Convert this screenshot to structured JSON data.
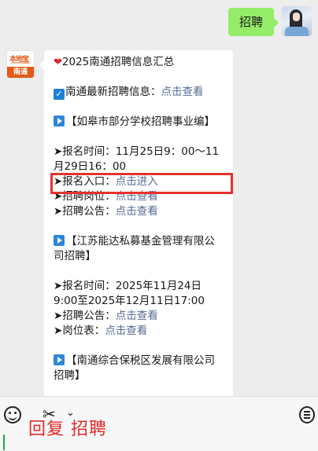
{
  "outgoing": {
    "text": "招聘"
  },
  "incoming": {
    "avatar": {
      "logo_text": "本地宝",
      "city": "南通"
    },
    "title": "2025南通招聘信息汇总",
    "latest": {
      "label": "南通最新招聘信息：",
      "link": "点击查看"
    },
    "sections": [
      {
        "heading": "【如皋市部分学校招聘事业编】",
        "time_label": "➤报名时间：",
        "time_value_1": "11月25日9：00～11",
        "time_value_2": "月29日16：00",
        "entry_label": "➤报名入口：",
        "entry_link": "点击进入",
        "post_label": "➤招聘岗位：",
        "post_link": "点击查看",
        "notice_label": "➤招聘公告：",
        "notice_link": "点击查看"
      },
      {
        "heading_1": "【江苏能达私募基金管理有限公",
        "heading_2": "司招聘】",
        "time_label": "➤报名时间：",
        "time_value_1": "2025年11月24日",
        "time_value_2": "9:00至2025年12月11日17:00",
        "notice_label": "➤招聘公告：",
        "notice_link": "点击查看",
        "table_label": "➤岗位表：",
        "table_link": "点击查看"
      },
      {
        "heading_1": "【南通综合保税区发展有限公司",
        "heading_2": "招聘】"
      }
    ]
  },
  "input": {
    "typed_overlay": "回复 招聘"
  },
  "icons": {
    "emoji": "emoji-icon",
    "scissors": "scissors-icon",
    "chevron": "chevron-down-icon",
    "menu": "menu-icon"
  },
  "colors": {
    "bubble_out": "#95ec69",
    "link": "#576b95",
    "highlight": "#e5322d",
    "overlay_text": "#e52a2a"
  }
}
